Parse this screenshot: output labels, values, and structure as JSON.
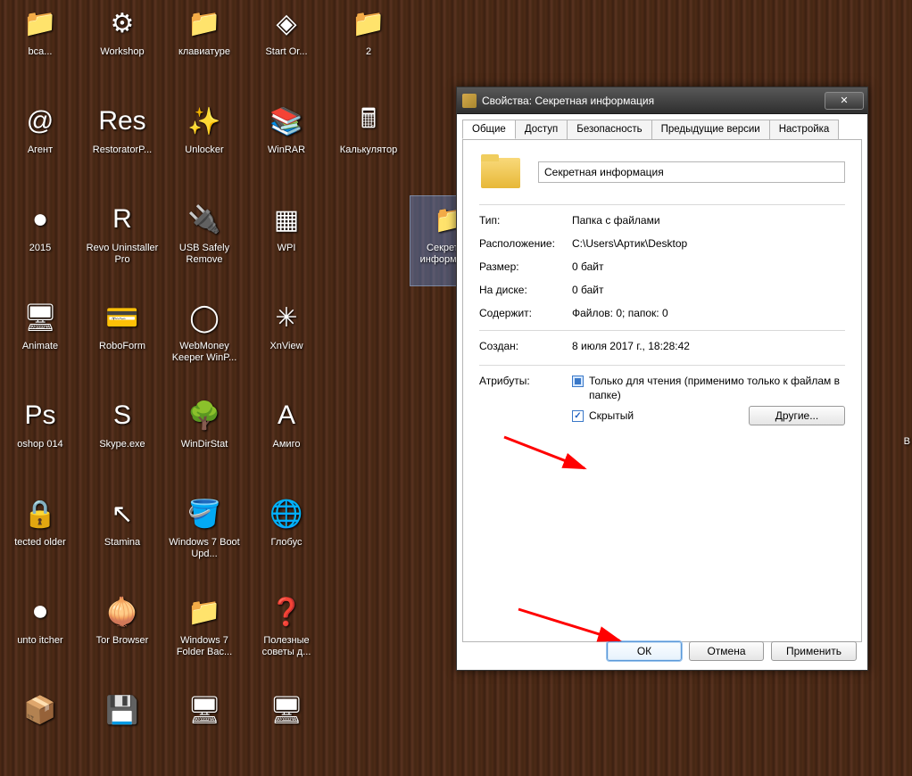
{
  "desktop": {
    "icons": [
      {
        "label": "bca...",
        "glyph": "📁"
      },
      {
        "label": "Workshop",
        "glyph": "⚙"
      },
      {
        "label": "клавиатуре",
        "glyph": "📁"
      },
      {
        "label": "Start Or...",
        "glyph": "◈"
      },
      {
        "label": "2",
        "glyph": "📁"
      },
      {
        "label": "",
        "glyph": ""
      },
      {
        "label": "Агент",
        "glyph": "@"
      },
      {
        "label": "RestoratorP...",
        "glyph": "Res"
      },
      {
        "label": "Unlocker",
        "glyph": "✨"
      },
      {
        "label": "WinRAR",
        "glyph": "📚"
      },
      {
        "label": "Калькулятор",
        "glyph": "🖩"
      },
      {
        "label": "",
        "glyph": ""
      },
      {
        "label": "2015",
        "glyph": "●"
      },
      {
        "label": "Revo Uninstaller Pro",
        "glyph": "R"
      },
      {
        "label": "USB Safely Remove",
        "glyph": "🔌"
      },
      {
        "label": "WPI",
        "glyph": "▦"
      },
      {
        "label": "",
        "glyph": ""
      },
      {
        "label": "Секретная информаци...",
        "glyph": "📁",
        "selected": true
      },
      {
        "label": "Animate",
        "glyph": "🖥"
      },
      {
        "label": "RoboForm",
        "glyph": "💳"
      },
      {
        "label": "WebMoney Keeper WinP...",
        "glyph": "◯"
      },
      {
        "label": "XnView",
        "glyph": "✳"
      },
      {
        "label": "",
        "glyph": ""
      },
      {
        "label": "",
        "glyph": ""
      },
      {
        "label": "oshop 014",
        "glyph": "Ps"
      },
      {
        "label": "Skype.exe",
        "glyph": "S"
      },
      {
        "label": "WinDirStat",
        "glyph": "🌳"
      },
      {
        "label": "Амиго",
        "glyph": "A"
      },
      {
        "label": "",
        "glyph": ""
      },
      {
        "label": "",
        "glyph": ""
      },
      {
        "label": "tected older",
        "glyph": "🔒"
      },
      {
        "label": "Stamina",
        "glyph": "↖"
      },
      {
        "label": "Windows 7 Boot Upd...",
        "glyph": "🪣"
      },
      {
        "label": "Глобус",
        "glyph": "🌐"
      },
      {
        "label": "",
        "glyph": ""
      },
      {
        "label": "",
        "glyph": ""
      },
      {
        "label": "unto itcher",
        "glyph": "⏺"
      },
      {
        "label": "Tor Browser",
        "glyph": "🧅"
      },
      {
        "label": "Windows 7 Folder Bac...",
        "glyph": "📁"
      },
      {
        "label": "Полезные советы д...",
        "glyph": "❓"
      },
      {
        "label": "",
        "glyph": ""
      },
      {
        "label": "",
        "glyph": ""
      },
      {
        "label": "",
        "glyph": "📦"
      },
      {
        "label": "",
        "glyph": "💾"
      },
      {
        "label": "",
        "glyph": "🖥"
      },
      {
        "label": "",
        "glyph": "🖥"
      }
    ]
  },
  "right_cut_label": "В",
  "dialog": {
    "title": "Свойства: Секретная информация",
    "tabs": [
      "Общие",
      "Доступ",
      "Безопасность",
      "Предыдущие версии",
      "Настройка"
    ],
    "active_tab": 0,
    "folder_name": "Секретная информация",
    "fields": {
      "type_label": "Тип:",
      "type_value": "Папка с файлами",
      "location_label": "Расположение:",
      "location_value": "C:\\Users\\Артик\\Desktop",
      "size_label": "Размер:",
      "size_value": "0 байт",
      "ondisk_label": "На диске:",
      "ondisk_value": "0 байт",
      "contains_label": "Содержит:",
      "contains_value": "Файлов: 0; папок: 0",
      "created_label": "Создан:",
      "created_value": "8 июля 2017 г., 18:28:42"
    },
    "attributes": {
      "label": "Атрибуты:",
      "readonly_label": "Только для чтения (применимо только к файлам в папке)",
      "hidden_label": "Скрытый",
      "hidden_checked": true,
      "other_button": "Другие..."
    },
    "buttons": {
      "ok": "ОК",
      "cancel": "Отмена",
      "apply": "Применить"
    }
  }
}
